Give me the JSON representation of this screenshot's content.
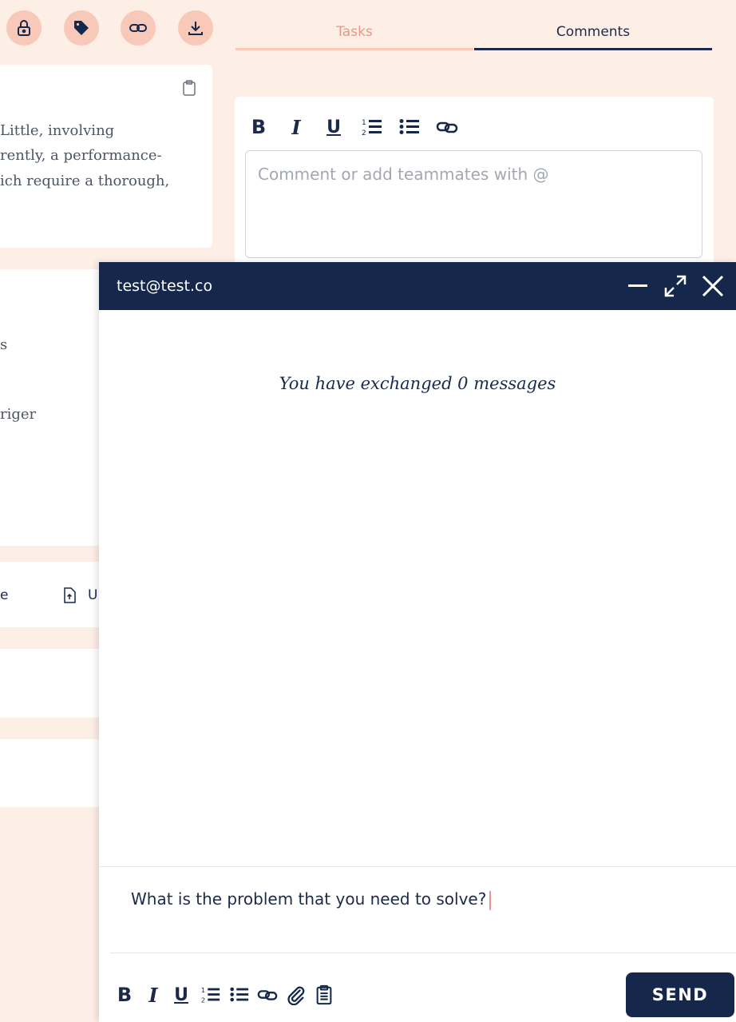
{
  "tabs": {
    "tasks": "Tasks",
    "comments": "Comments"
  },
  "description": {
    "lines": [
      "Little, involving",
      "rently, a performance-",
      "ich require a thorough,"
    ]
  },
  "details": {
    "line1": "s",
    "line2": "riger"
  },
  "attachments": {
    "partial1": "e",
    "upload_partial": "U"
  },
  "comment": {
    "placeholder": "Comment or add teammates with @"
  },
  "chat": {
    "title": "test@test.co",
    "exchanged": "You have exchanged 0 messages",
    "input_value": "What is the problem that you need to solve?",
    "send_label": "SEND"
  },
  "colors": {
    "navy": "#15284b",
    "peach": "#fdeee6",
    "accent": "#f8c9b8",
    "tab_inactive": "#e7988a"
  }
}
